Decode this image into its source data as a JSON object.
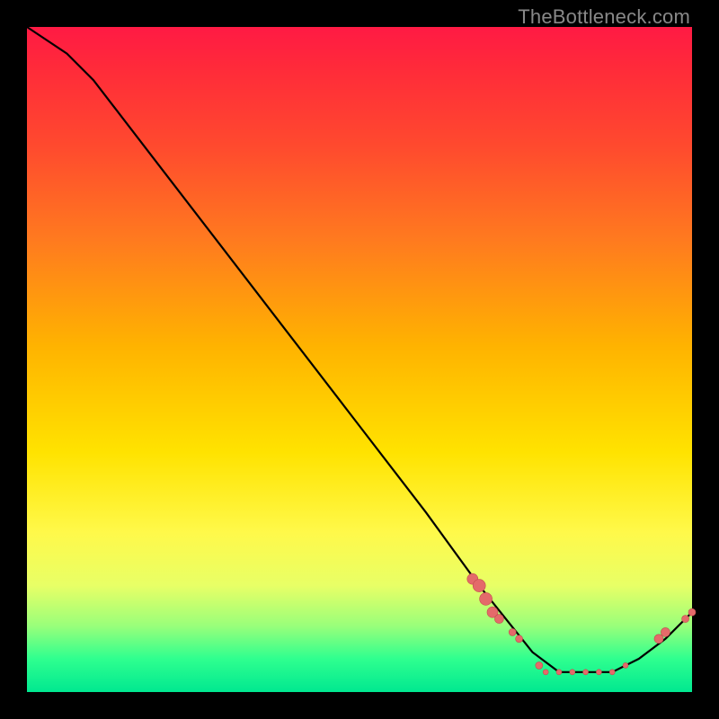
{
  "watermark": "TheBottleneck.com",
  "colors": {
    "line": "#000000",
    "marker_fill": "#e46a6a",
    "marker_stroke": "#c24d4d",
    "frame_bg": "#000000"
  },
  "chart_data": {
    "type": "line",
    "title": "",
    "xlabel": "",
    "ylabel": "",
    "xlim": [
      0,
      100
    ],
    "ylim": [
      0,
      100
    ],
    "grid": false,
    "legend": false,
    "series": [
      {
        "name": "bottleneck-curve",
        "x": [
          0,
          6,
          10,
          20,
          30,
          40,
          50,
          60,
          68,
          72,
          76,
          80,
          84,
          88,
          92,
          96,
          100
        ],
        "y": [
          100,
          96,
          92,
          79,
          66,
          53,
          40,
          27,
          16,
          11,
          6,
          3,
          3,
          3,
          5,
          8,
          12
        ]
      }
    ],
    "markers": [
      {
        "x": 67,
        "y": 17,
        "r": 6
      },
      {
        "x": 68,
        "y": 16,
        "r": 7
      },
      {
        "x": 69,
        "y": 14,
        "r": 7
      },
      {
        "x": 70,
        "y": 12,
        "r": 6
      },
      {
        "x": 71,
        "y": 11,
        "r": 5
      },
      {
        "x": 73,
        "y": 9,
        "r": 4
      },
      {
        "x": 74,
        "y": 8,
        "r": 4
      },
      {
        "x": 77,
        "y": 4,
        "r": 4
      },
      {
        "x": 78,
        "y": 3,
        "r": 3
      },
      {
        "x": 80,
        "y": 3,
        "r": 3
      },
      {
        "x": 82,
        "y": 3,
        "r": 3
      },
      {
        "x": 84,
        "y": 3,
        "r": 3
      },
      {
        "x": 86,
        "y": 3,
        "r": 3
      },
      {
        "x": 88,
        "y": 3,
        "r": 3
      },
      {
        "x": 90,
        "y": 4,
        "r": 3
      },
      {
        "x": 95,
        "y": 8,
        "r": 5
      },
      {
        "x": 96,
        "y": 9,
        "r": 5
      },
      {
        "x": 99,
        "y": 11,
        "r": 4
      },
      {
        "x": 100,
        "y": 12,
        "r": 4
      }
    ]
  }
}
